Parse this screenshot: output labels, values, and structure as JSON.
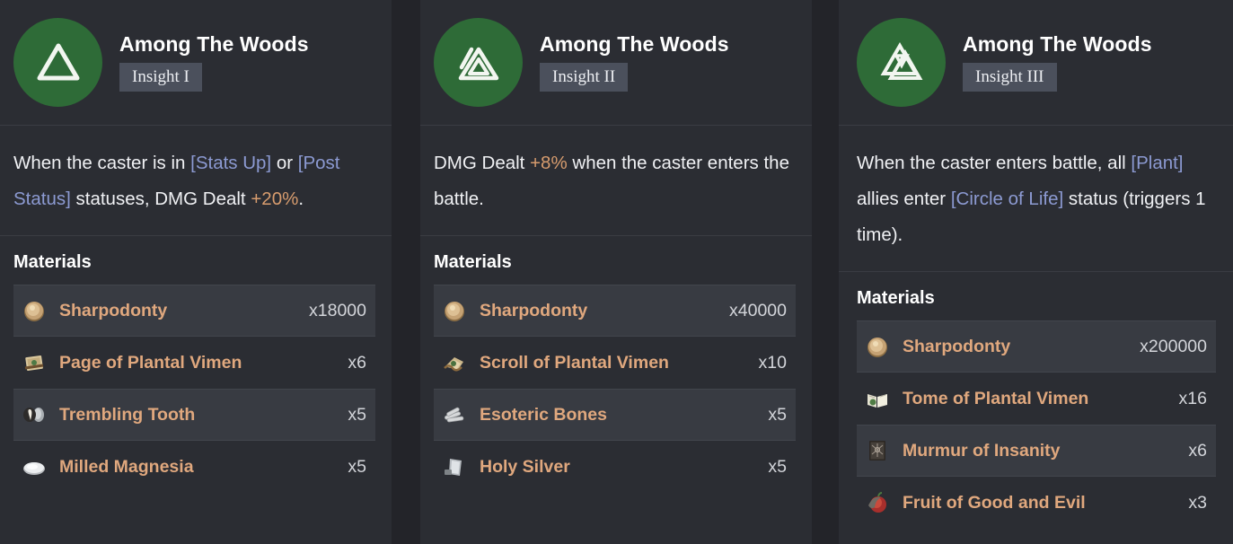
{
  "theme": {
    "background": "#232429",
    "panel_bg": "#2b2d33",
    "row_alt_bg": "#383b42",
    "emblem_green": "#2e6b37",
    "badge_bg": "#4b505c",
    "material_name_color": "#e0a87e",
    "tag_color": "#8c9ad2",
    "number_highlight_color": "#d79c6e",
    "divider_color": "#3a3c43"
  },
  "materials_heading": "Materials",
  "panels": [
    {
      "title": "Among The Woods",
      "badge": "Insight I",
      "emblem_icon": "triangle-outline-icon",
      "description": [
        {
          "text": "When the caster is in ",
          "style": "normal"
        },
        {
          "text": "[Stats Up]",
          "style": "tag"
        },
        {
          "text": " or ",
          "style": "normal"
        },
        {
          "text": "[Post Status]",
          "style": "tag"
        },
        {
          "text": " statuses, DMG Dealt ",
          "style": "normal"
        },
        {
          "text": "+20%",
          "style": "num"
        },
        {
          "text": ".",
          "style": "normal"
        }
      ],
      "materials": [
        {
          "icon": "gold-coin-icon",
          "name": "Sharpodonty",
          "qty": "x18000"
        },
        {
          "icon": "page-scroll-icon",
          "name": "Page of Plantal Vimen",
          "qty": "x6"
        },
        {
          "icon": "tooth-icon",
          "name": "Trembling Tooth",
          "qty": "x5"
        },
        {
          "icon": "magnesia-bowl-icon",
          "name": "Milled Magnesia",
          "qty": "x5"
        }
      ]
    },
    {
      "title": "Among The Woods",
      "badge": "Insight II",
      "emblem_icon": "double-triangle-icon",
      "description": [
        {
          "text": "DMG Dealt ",
          "style": "normal"
        },
        {
          "text": "+8%",
          "style": "num"
        },
        {
          "text": " when the caster enters the battle.",
          "style": "normal"
        }
      ],
      "materials": [
        {
          "icon": "gold-coin-icon",
          "name": "Sharpodonty",
          "qty": "x40000"
        },
        {
          "icon": "rolled-scroll-icon",
          "name": "Scroll of Plantal Vimen",
          "qty": "x10"
        },
        {
          "icon": "bones-icon",
          "name": "Esoteric Bones",
          "qty": "x5"
        },
        {
          "icon": "silver-ingot-icon",
          "name": "Holy Silver",
          "qty": "x5"
        }
      ]
    },
    {
      "title": "Among The Woods",
      "badge": "Insight III",
      "emblem_icon": "valknut-triangle-icon",
      "description": [
        {
          "text": "When the caster enters battle, all ",
          "style": "normal"
        },
        {
          "text": "[Plant]",
          "style": "tag"
        },
        {
          "text": " allies enter ",
          "style": "normal"
        },
        {
          "text": "[Circle of Life]",
          "style": "tag"
        },
        {
          "text": " status (triggers 1 time).",
          "style": "normal"
        }
      ],
      "materials": [
        {
          "icon": "gold-coin-icon",
          "name": "Sharpodonty",
          "qty": "x200000"
        },
        {
          "icon": "open-book-icon",
          "name": "Tome of Plantal Vimen",
          "qty": "x16"
        },
        {
          "icon": "dark-book-icon",
          "name": "Murmur of Insanity",
          "qty": "x6"
        },
        {
          "icon": "red-fruit-icon",
          "name": "Fruit of Good and Evil",
          "qty": "x3"
        }
      ]
    }
  ]
}
